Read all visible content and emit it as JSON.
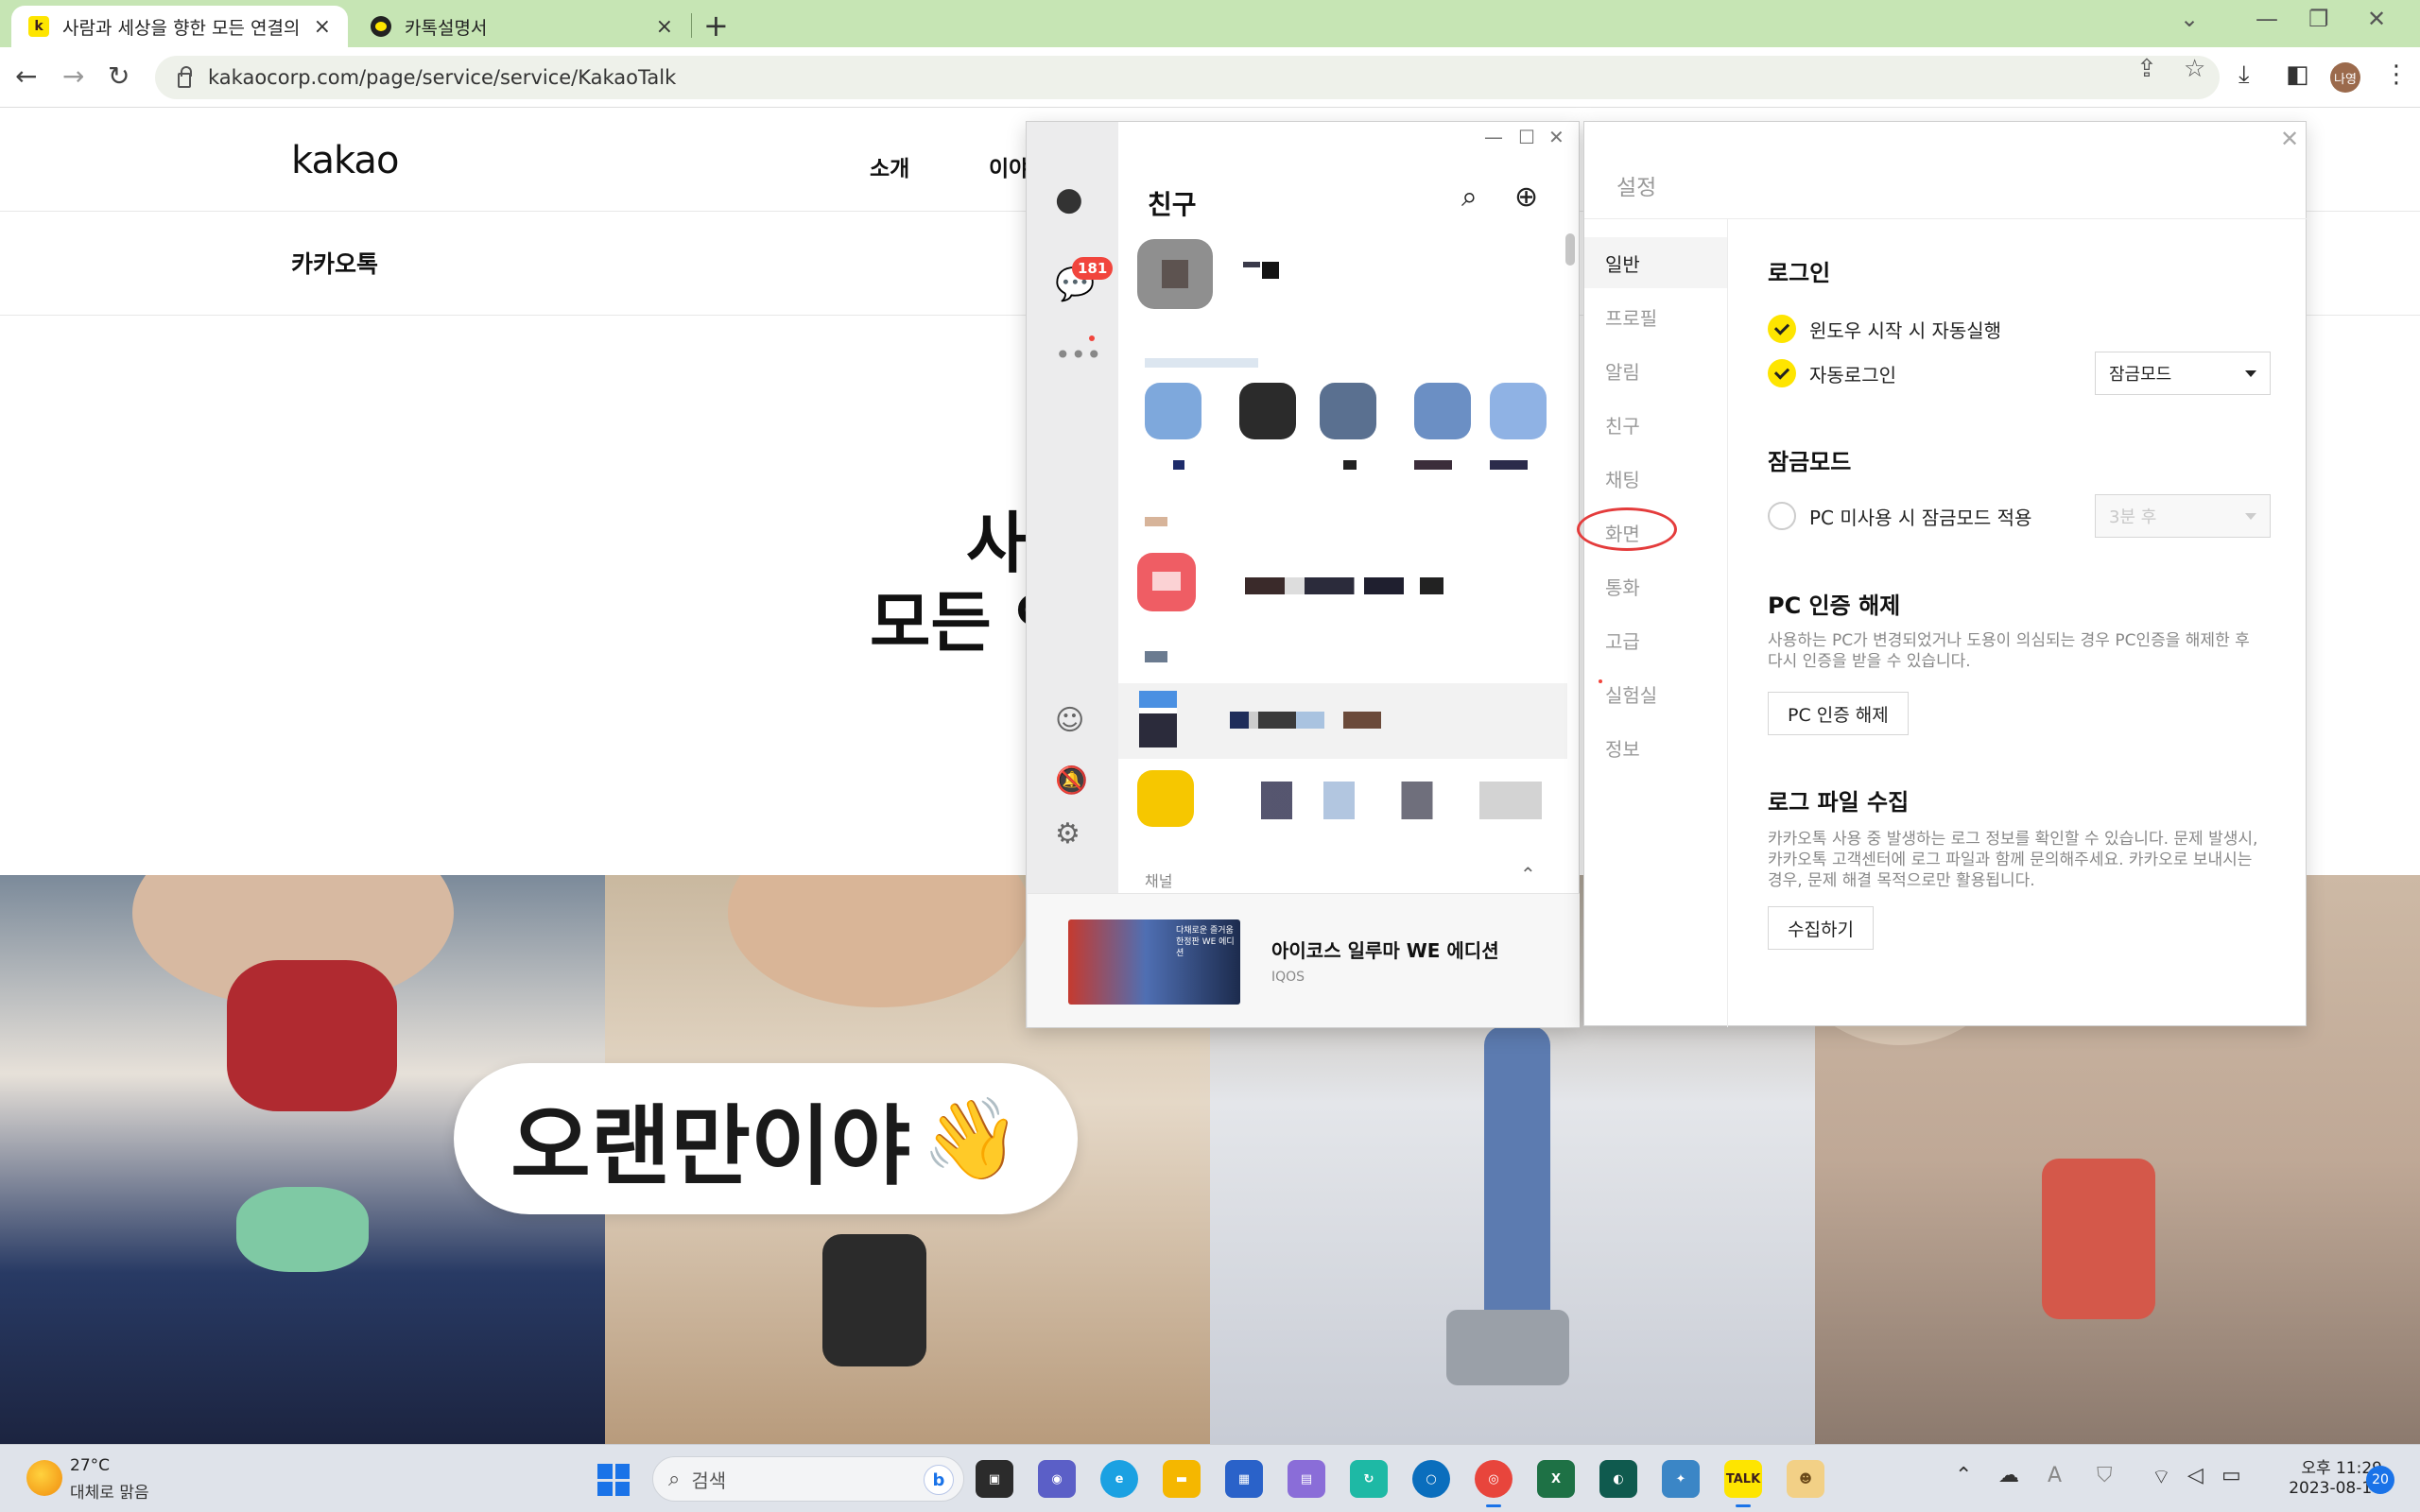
{
  "browser": {
    "tabs": [
      {
        "title": "사람과 세상을 향한 모든 연결의",
        "favicon": "kakao-favicon"
      },
      {
        "title": "카톡설명서",
        "favicon": "kakaotalk-favicon"
      }
    ],
    "url": "kakaocorp.com/page/service/service/KakaoTalk",
    "profile_initials": "나영"
  },
  "page": {
    "logo": "kakao",
    "nav": [
      "소개",
      "이야"
    ],
    "sub_nav": "카카오톡",
    "hero_line1": "사",
    "hero_line2": "모든 인",
    "bubble_text": "오랜만이야",
    "bubble_emoji": "👋"
  },
  "kakaotalk": {
    "title": "친구",
    "unread_badge": "181",
    "section_channel": "채널",
    "ad": {
      "title": "아이코스 일루마 WE 에디션",
      "brand": "IQOS",
      "image_text": "다채로운 즐거움 한정판 WE 에디션"
    }
  },
  "settings": {
    "title": "설정",
    "menu": [
      "일반",
      "프로필",
      "알림",
      "친구",
      "채팅",
      "화면",
      "통화",
      "고급",
      "실험실",
      "정보"
    ],
    "active_menu": "일반",
    "login": {
      "heading": "로그인",
      "autostart": "윈도우 시작 시 자동실행",
      "autologin": "자동로그인",
      "autologin_mode": "잠금모드"
    },
    "lock": {
      "heading": "잠금모드",
      "idle_label": "PC 미사용 시 잠금모드 적용",
      "idle_time": "3분 후"
    },
    "pc_auth": {
      "heading": "PC 인증 해제",
      "desc": "사용하는 PC가 변경되었거나 도용이 의심되는 경우 PC인증을 해제한 후 다시 인증을 받을 수 있습니다.",
      "button": "PC 인증 해제"
    },
    "log": {
      "heading": "로그 파일 수집",
      "desc": "카카오톡 사용 중 발생하는 로그 정보를 확인할 수 있습니다. 문제 발생시, 카카오톡 고객센터에 로그 파일과 함께 문의해주세요. 카카오로 보내시는 경우, 문제 해결 목적으로만 활용됩니다.",
      "button": "수집하기"
    }
  },
  "taskbar": {
    "temperature": "27°C",
    "weather": "대체로 맑음",
    "search_placeholder": "검색",
    "time": "오후 11:29",
    "date": "2023-08-17",
    "notifications": "20"
  },
  "colors": {
    "kakao_yellow": "#fee500",
    "badge_red": "#f1453d",
    "chrome_green": "#c6e5b4"
  }
}
